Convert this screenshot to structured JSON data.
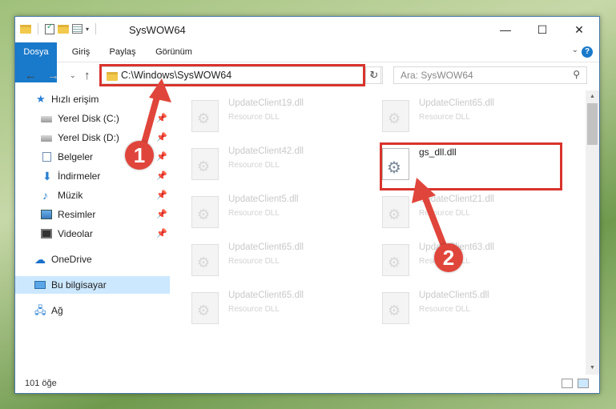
{
  "window": {
    "title": "SysWOW64",
    "controls": {
      "minimize": "—",
      "maximize": "☐",
      "close": "✕"
    }
  },
  "ribbon": {
    "tabs": [
      "Dosya",
      "Giriş",
      "Paylaş",
      "Görünüm"
    ],
    "help": "?"
  },
  "address": {
    "path": "C:\\Windows\\SysWOW64",
    "search_placeholder": "Ara: SysWOW64"
  },
  "nav": {
    "items": [
      {
        "label": "Hızlı erişim",
        "icon": "star-icon",
        "pinned": false
      },
      {
        "label": "Yerel Disk (C:)",
        "icon": "disk-icon",
        "pinned": true
      },
      {
        "label": "Yerel Disk (D:)",
        "icon": "disk-icon",
        "pinned": true
      },
      {
        "label": "Belgeler",
        "icon": "documents-icon",
        "pinned": true
      },
      {
        "label": "İndirmeler",
        "icon": "download-icon",
        "pinned": true
      },
      {
        "label": "Müzik",
        "icon": "music-icon",
        "pinned": true
      },
      {
        "label": "Resimler",
        "icon": "pictures-icon",
        "pinned": true
      },
      {
        "label": "Videolar",
        "icon": "videos-icon",
        "pinned": true
      },
      {
        "label": "OneDrive",
        "icon": "cloud-icon",
        "pinned": false
      },
      {
        "label": "Bu bilgisayar",
        "icon": "computer-icon",
        "pinned": false,
        "selected": true
      },
      {
        "label": "Ağ",
        "icon": "network-icon",
        "pinned": false
      }
    ]
  },
  "files": [
    {
      "name": "UpdateClient19.dll",
      "type": "Resource DLL"
    },
    {
      "name": "UpdateClient65.dll",
      "type": "Resource DLL"
    },
    {
      "name": "UpdateClient42.dll",
      "type": "Resource DLL"
    },
    {
      "name": "gs_dll.dll",
      "type": "",
      "highlighted": true
    },
    {
      "name": "UpdateClient5.dll",
      "type": "Resource DLL"
    },
    {
      "name": "UpdateClient21.dll",
      "type": "Resource DLL"
    },
    {
      "name": "UpdateClient65.dll",
      "type": "Resource DLL"
    },
    {
      "name": "UpdateClient63.dll",
      "type": "Resource DLL"
    },
    {
      "name": "UpdateClient65.dll",
      "type": "Resource DLL"
    },
    {
      "name": "UpdateClient5.dll",
      "type": "Resource DLL"
    }
  ],
  "status": {
    "item_count": "101 öğe"
  },
  "annotations": {
    "badge1": "1",
    "badge2": "2",
    "color": "#e0453b"
  }
}
